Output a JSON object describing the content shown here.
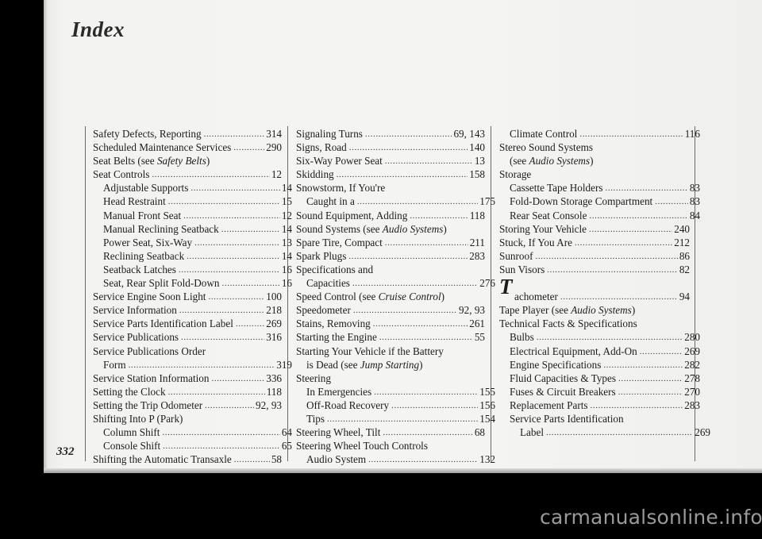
{
  "page": {
    "running_head": "Index",
    "folio": "332",
    "watermark": "carmanualsonline.info"
  },
  "columns": [
    {
      "id": "col-1",
      "entries": [
        {
          "label": "Safety Defects, Reporting",
          "page": "314",
          "indent": 0,
          "leader": true
        },
        {
          "label": "Scheduled Maintenance Services",
          "page": "290",
          "indent": 0,
          "leader": true
        },
        {
          "label": "Seat Belts (see ",
          "label_italic": "Safety Belts",
          "label_tail": ")",
          "page": "",
          "indent": 0,
          "leader": false
        },
        {
          "label": "Seat Controls",
          "page": "12",
          "indent": 0,
          "leader": true
        },
        {
          "label": "Adjustable Supports",
          "page": "14",
          "indent": 1,
          "leader": true
        },
        {
          "label": "Head Restraint",
          "page": "15",
          "indent": 1,
          "leader": true
        },
        {
          "label": "Manual Front Seat",
          "page": "12",
          "indent": 1,
          "leader": true
        },
        {
          "label": "Manual Reclining Seatback",
          "page": "14",
          "indent": 1,
          "leader": true
        },
        {
          "label": "Power Seat, Six-Way",
          "page": "13",
          "indent": 1,
          "leader": true
        },
        {
          "label": "Reclining Seatback",
          "page": "14",
          "indent": 1,
          "leader": true
        },
        {
          "label": "Seatback Latches",
          "page": "16",
          "indent": 1,
          "leader": true
        },
        {
          "label": "Seat, Rear Split Fold-Down",
          "page": "16",
          "indent": 1,
          "leader": true
        },
        {
          "label": "Service Engine Soon Light",
          "page": "100",
          "indent": 0,
          "leader": true
        },
        {
          "label": "Service Information",
          "page": "218",
          "indent": 0,
          "leader": true
        },
        {
          "label": "Service Parts Identification Label",
          "page": "269",
          "indent": 0,
          "leader": true
        },
        {
          "label": "Service Publications",
          "page": "316",
          "indent": 0,
          "leader": true
        },
        {
          "label": "Service Publications Order",
          "page": "",
          "indent": 0,
          "leader": false
        },
        {
          "label": "Form",
          "page": "319",
          "indent": 1,
          "leader": true
        },
        {
          "label": "Service Station Information",
          "page": "336",
          "indent": 0,
          "leader": true
        },
        {
          "label": "Setting the Clock",
          "page": "118",
          "indent": 0,
          "leader": true
        },
        {
          "label": "Setting the Trip Odometer",
          "page": "92, 93",
          "indent": 0,
          "leader": true
        },
        {
          "label": "Shifting Into P (Park)",
          "page": "",
          "indent": 0,
          "leader": false
        },
        {
          "label": "Column Shift",
          "page": "64",
          "indent": 1,
          "leader": true
        },
        {
          "label": "Console Shift",
          "page": "65",
          "indent": 1,
          "leader": true
        },
        {
          "label": "Shifting the Automatic Transaxle",
          "page": "58",
          "indent": 0,
          "leader": true
        }
      ]
    },
    {
      "id": "col-2",
      "entries": [
        {
          "label": "Signaling Turns",
          "page": "69, 143",
          "indent": 0,
          "leader": true
        },
        {
          "label": "Signs, Road",
          "page": "140",
          "indent": 0,
          "leader": true
        },
        {
          "label": "Six-Way Power Seat",
          "page": "13",
          "indent": 0,
          "leader": true
        },
        {
          "label": "Skidding",
          "page": "158",
          "indent": 0,
          "leader": true
        },
        {
          "label": "Snowstorm, If You're",
          "page": "",
          "indent": 0,
          "leader": false
        },
        {
          "label": "Caught in a",
          "page": "175",
          "indent": 1,
          "leader": true
        },
        {
          "label": "Sound Equipment, Adding",
          "page": "118",
          "indent": 0,
          "leader": true
        },
        {
          "label": "Sound Systems (see ",
          "label_italic": "Audio Systems",
          "label_tail": ")",
          "page": "",
          "indent": 0,
          "leader": false
        },
        {
          "label": "Spare Tire, Compact",
          "page": "211",
          "indent": 0,
          "leader": true
        },
        {
          "label": "Spark Plugs",
          "page": "283",
          "indent": 0,
          "leader": true
        },
        {
          "label": "Specifications and",
          "page": "",
          "indent": 0,
          "leader": false
        },
        {
          "label": "Capacities",
          "page": "276",
          "indent": 1,
          "leader": true
        },
        {
          "label": "Speed Control (see ",
          "label_italic": "Cruise Control",
          "label_tail": ")",
          "page": "",
          "indent": 0,
          "leader": false
        },
        {
          "label": "Speedometer",
          "page": "92, 93",
          "indent": 0,
          "leader": true
        },
        {
          "label": "Stains, Removing",
          "page": "261",
          "indent": 0,
          "leader": true
        },
        {
          "label": "Starting the Engine",
          "page": "55",
          "indent": 0,
          "leader": true
        },
        {
          "label": "Starting Your Vehicle if the Battery",
          "page": "",
          "indent": 0,
          "leader": false
        },
        {
          "label": "is Dead (see ",
          "label_italic": "Jump Starting",
          "label_tail": ")",
          "page": "",
          "indent": 1,
          "leader": false
        },
        {
          "label": "Steering",
          "page": "",
          "indent": 0,
          "leader": false
        },
        {
          "label": "In Emergencies",
          "page": "155",
          "indent": 1,
          "leader": true
        },
        {
          "label": "Off-Road Recovery",
          "page": "156",
          "indent": 1,
          "leader": true
        },
        {
          "label": "Tips",
          "page": "154",
          "indent": 1,
          "leader": true
        },
        {
          "label": "Steering Wheel, Tilt",
          "page": "68",
          "indent": 0,
          "leader": true
        },
        {
          "label": "Steering Wheel Touch Controls",
          "page": "",
          "indent": 0,
          "leader": false
        },
        {
          "label": "Audio System",
          "page": "132",
          "indent": 1,
          "leader": true
        }
      ]
    },
    {
      "id": "col-3",
      "entries": [
        {
          "label": "Climate Control",
          "page": "116",
          "indent": 1,
          "leader": true
        },
        {
          "label": "Stereo Sound Systems",
          "page": "",
          "indent": 0,
          "leader": false
        },
        {
          "label": "(see ",
          "label_italic": "Audio Systems",
          "label_tail": ")",
          "page": "",
          "indent": 1,
          "leader": false
        },
        {
          "label": "Storage",
          "page": "",
          "indent": 0,
          "leader": false
        },
        {
          "label": "Cassette Tape Holders",
          "page": "83",
          "indent": 1,
          "leader": true
        },
        {
          "label": "Fold-Down Storage Compartment",
          "page": "83",
          "indent": 1,
          "leader": true
        },
        {
          "label": "Rear Seat Console",
          "page": "84",
          "indent": 1,
          "leader": true
        },
        {
          "label": "Storing Your Vehicle",
          "page": "240",
          "indent": 0,
          "leader": true
        },
        {
          "label": "Stuck, If You Are",
          "page": "212",
          "indent": 0,
          "leader": true
        },
        {
          "label": "Sunroof",
          "page": "86",
          "indent": 0,
          "leader": true
        },
        {
          "label": "Sun Visors",
          "page": "82",
          "indent": 0,
          "leader": true
        }
      ],
      "letter_heading": {
        "cap": "T",
        "rest": "achometer",
        "page": "94"
      },
      "entries_after": [
        {
          "label": "Tape Player (see ",
          "label_italic": "Audio Systems",
          "label_tail": ")",
          "page": "",
          "indent": 0,
          "leader": false
        },
        {
          "label": "Technical Facts & Specifications",
          "page": "",
          "indent": 0,
          "leader": false
        },
        {
          "label": "Bulbs",
          "page": "280",
          "indent": 1,
          "leader": true
        },
        {
          "label": "Electrical Equipment, Add-On",
          "page": "269",
          "indent": 1,
          "leader": true
        },
        {
          "label": "Engine Specifications",
          "page": "282",
          "indent": 1,
          "leader": true
        },
        {
          "label": "Fluid Capacities & Types",
          "page": "278",
          "indent": 1,
          "leader": true
        },
        {
          "label": "Fuses & Circuit Breakers",
          "page": "270",
          "indent": 1,
          "leader": true
        },
        {
          "label": "Replacement Parts",
          "page": "283",
          "indent": 1,
          "leader": true
        },
        {
          "label": "Service Parts Identification",
          "page": "",
          "indent": 1,
          "leader": false
        },
        {
          "label": "Label",
          "page": "269",
          "indent": 2,
          "leader": true
        }
      ]
    }
  ]
}
